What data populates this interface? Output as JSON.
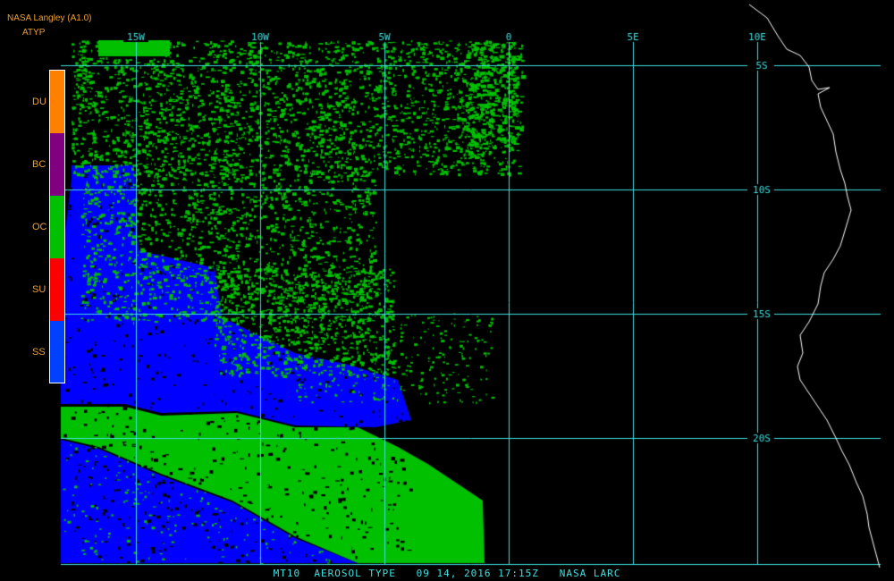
{
  "header": {
    "source": "NASA Langley (A1.0)",
    "product": "ATYP"
  },
  "legend": {
    "items": [
      {
        "label": "DU",
        "color": "#ff8000"
      },
      {
        "label": "BC",
        "color": "#800080"
      },
      {
        "label": "OC",
        "color": "#00c000"
      },
      {
        "label": "SU",
        "color": "#ff0000"
      },
      {
        "label": "SS",
        "color": "#0040ff"
      }
    ]
  },
  "grid": {
    "color": "#40e0e0",
    "lon_labels": [
      "15W",
      "10W",
      "5W",
      "0",
      "5E",
      "10E"
    ],
    "lat_labels": [
      "5S",
      "10S",
      "15S",
      "20S"
    ]
  },
  "colors": {
    "background": "#000000",
    "coastline": "#ffffff",
    "ocean_cloud_green": "#00c000",
    "sea_salt_blue": "#0000ff"
  },
  "footer": {
    "text": "MT10  AEROSOL TYPE   09 14, 2016 17:15Z   NASA LARC"
  }
}
